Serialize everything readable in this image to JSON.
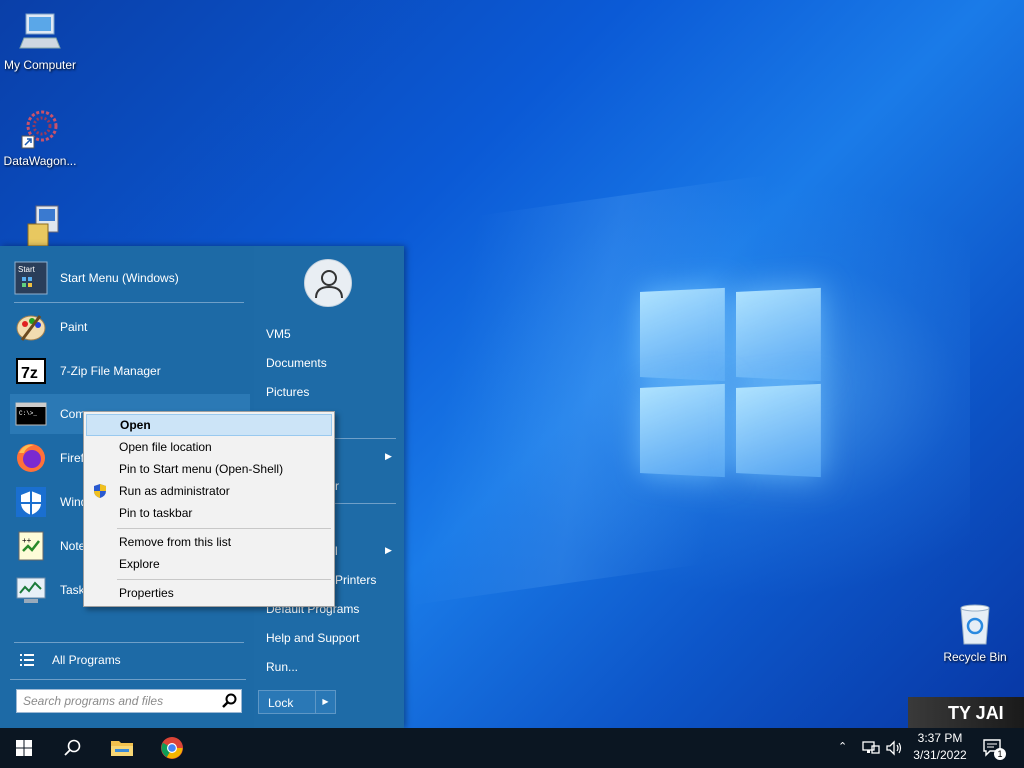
{
  "desktop": {
    "icons": [
      {
        "label": "My Computer",
        "icon": "computer-icon"
      },
      {
        "label": "DataWagon...",
        "icon": "datawagon-icon"
      },
      {
        "label": "",
        "icon": "installer-icon"
      },
      {
        "label": "Recycle Bin",
        "icon": "recycle-bin-icon"
      }
    ],
    "thumbnail_text": "TY JAI"
  },
  "start_menu": {
    "pinned": [
      {
        "label": "Start Menu (Windows)",
        "icon": "start-menu-icon"
      },
      {
        "label": "Paint",
        "icon": "paint-icon"
      },
      {
        "label": "7-Zip File Manager",
        "icon": "7zip-icon"
      },
      {
        "label": "Command Prompt",
        "icon": "cmd-icon"
      },
      {
        "label": "Firefox",
        "icon": "firefox-icon"
      },
      {
        "label": "Windows Security",
        "icon": "shield-icon"
      },
      {
        "label": "Notepad++",
        "icon": "notepadpp-icon"
      },
      {
        "label": "Task Manager",
        "icon": "task-manager-icon"
      }
    ],
    "visible_labels": {
      "cmd": "Comm",
      "cmd_tail": "t",
      "firefox": "Firef",
      "security": "Wind",
      "notepad": "Note",
      "task": "Task"
    },
    "all_programs": "All Programs",
    "search_placeholder": "Search programs and files",
    "right": {
      "user": "VM5",
      "items": [
        "Documents",
        "Pictures",
        "Default Programs",
        "Help and Support",
        "Run..."
      ],
      "partial": {
        "r1": "r",
        "r2": "l",
        "printers": "Printers"
      }
    },
    "lock": "Lock"
  },
  "context_menu": {
    "items": [
      {
        "label": "Open",
        "bold": true,
        "highlighted": true
      },
      {
        "label": "Open file location"
      },
      {
        "label": "Pin to Start menu (Open-Shell)"
      },
      {
        "label": "Run as administrator",
        "icon": "uac-shield-icon"
      },
      {
        "label": "Pin to taskbar"
      },
      {
        "label": "Remove from this list"
      },
      {
        "label": "Explore"
      },
      {
        "label": "Properties"
      }
    ]
  },
  "taskbar": {
    "time": "3:37 PM",
    "date": "3/31/2022",
    "notification_count": "1",
    "apps": [
      "windows-start-icon",
      "search-icon",
      "file-explorer-icon",
      "chrome-icon"
    ]
  },
  "colors": {
    "accent": "#1d6aa6",
    "context_highlight": "#cce4f7",
    "taskbar": "#0b1622"
  }
}
